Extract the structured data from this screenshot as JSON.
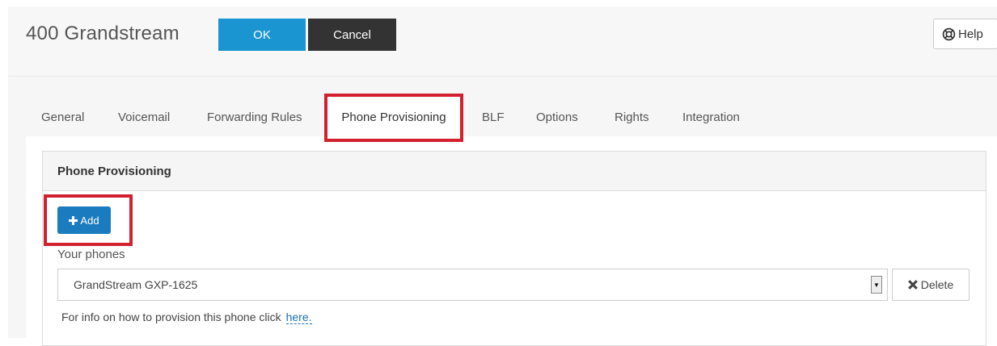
{
  "header": {
    "title": "400 Grandstream",
    "ok_label": "OK",
    "cancel_label": "Cancel",
    "help_label": "Help"
  },
  "tabs": [
    {
      "label": "General"
    },
    {
      "label": "Voicemail"
    },
    {
      "label": "Forwarding Rules"
    },
    {
      "label": "Phone Provisioning",
      "active": true
    },
    {
      "label": "BLF"
    },
    {
      "label": "Options"
    },
    {
      "label": "Rights"
    },
    {
      "label": "Integration"
    }
  ],
  "panel": {
    "title": "Phone Provisioning",
    "add_label": "Add",
    "phones_label": "Your phones",
    "selected_phone": "GrandStream GXP-1625",
    "delete_label": "Delete",
    "info_text": "For info on how to provision this phone click",
    "info_link": "here."
  },
  "colors": {
    "primary": "#1b94d2",
    "dark": "#333333",
    "highlight": "#d3202f"
  },
  "icons": {
    "help": "lifebuoy-icon",
    "add": "plus-icon",
    "delete": "times-icon",
    "dropdown": "caret-down-icon"
  }
}
